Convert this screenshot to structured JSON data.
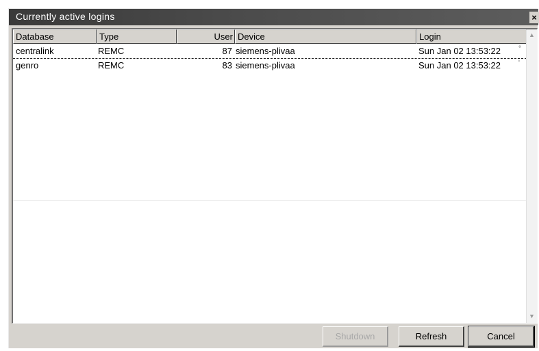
{
  "window": {
    "title": "Currently active logins",
    "close_glyph": "×"
  },
  "columns": {
    "database": "Database",
    "type": "Type",
    "user": "User",
    "device": "Device",
    "login": "Login"
  },
  "rows": [
    {
      "database": "centralink",
      "type": "REMC",
      "user": "87",
      "device": "siemens-plivaa",
      "login": "Sun Jan 02 13:53:22",
      "mark": "°"
    },
    {
      "database": "genro",
      "type": "REMC",
      "user": "83",
      "device": "siemens-plivaa",
      "login": "Sun Jan 02 13:53:22",
      "mark": "'"
    }
  ],
  "scrollbar": {
    "up_glyph": "▲",
    "down_glyph": "▼"
  },
  "buttons": {
    "shutdown": "Shutdown",
    "refresh": "Refresh",
    "cancel": "Cancel"
  }
}
